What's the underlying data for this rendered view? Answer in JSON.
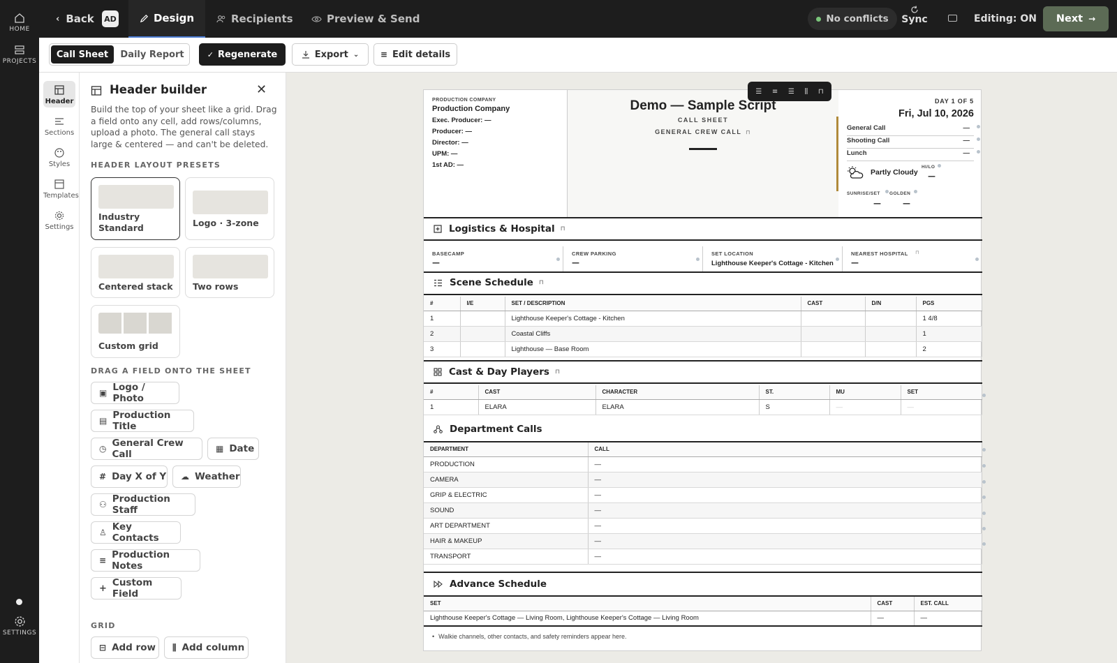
{
  "rail": {
    "home": "HOME",
    "projects": "PROJECTS",
    "settings": "SETTINGS"
  },
  "topbar": {
    "back": "Back",
    "avatar": "AD",
    "tabs": [
      "Design",
      "Recipients",
      "Preview & Send"
    ],
    "status": "No conflicts",
    "sync": "Sync",
    "editing": "Editing: ON",
    "next": "Next"
  },
  "toolbar": {
    "call_sheet": "Call Sheet",
    "daily_report": "Daily Report",
    "regenerate": "Regenerate",
    "export": "Export",
    "edit_details": "Edit details"
  },
  "iconcol": [
    "Header",
    "Sections",
    "Styles",
    "Templates",
    "Settings"
  ],
  "panel": {
    "title": "Header builder",
    "description": "Build the top of your sheet like a grid. Drag a field onto any cell, add rows/columns, upload a photo. The general call stays large & centered — and can't be deleted.",
    "presets_label": "HEADER LAYOUT PRESETS",
    "presets": [
      "Industry Standard",
      "Logo · 3-zone",
      "Centered stack",
      "Two rows",
      "Custom grid"
    ],
    "fields_label": "DRAG A FIELD ONTO THE SHEET",
    "fields": [
      "Logo / Photo",
      "Production Title",
      "General Crew Call",
      "Date",
      "Day X of Y",
      "Weather",
      "Production Staff",
      "Key Contacts",
      "Production Notes",
      "Custom Field"
    ],
    "grid_label": "GRID",
    "grid_buttons": [
      "Add row",
      "Add column"
    ]
  },
  "sheet": {
    "company_label": "PRODUCTION COMPANY",
    "company": "Production Company",
    "staff": [
      "Exec. Producer: —",
      "Producer: —",
      "Director: —",
      "UPM: —",
      "1st AD: —"
    ],
    "title": "Demo — Sample Script",
    "subtitle": "CALL SHEET",
    "crew_call_label": "GENERAL CREW CALL",
    "day": "DAY 1 OF 5",
    "date": "Fri, Jul 10, 2026",
    "calls": [
      {
        "label": "General Call",
        "value": "—"
      },
      {
        "label": "Shooting Call",
        "value": "—"
      },
      {
        "label": "Lunch",
        "value": "—"
      }
    ],
    "weather": "Partly Cloudy",
    "hilo_label": "HI/LO",
    "hilo": "—",
    "sunrise_label": "SUNRISE/SET",
    "sunrise": "—",
    "golden_label": "GOLDEN",
    "golden": "—",
    "logistics": {
      "title": "Logistics & Hospital",
      "cells": [
        {
          "label": "BASECAMP",
          "value": "—"
        },
        {
          "label": "CREW PARKING",
          "value": "—"
        },
        {
          "label": "SET LOCATION",
          "value": "Lighthouse Keeper's Cottage - Kitchen"
        },
        {
          "label": "NEAREST HOSPITAL",
          "value": "—"
        }
      ]
    },
    "scenes": {
      "title": "Scene Schedule",
      "headers": [
        "#",
        "I/E",
        "SET / DESCRIPTION",
        "CAST",
        "D/N",
        "PGS"
      ],
      "rows": [
        [
          "1",
          "",
          "Lighthouse Keeper's Cottage - Kitchen",
          "",
          "",
          "1 4/8"
        ],
        [
          "2",
          "",
          "Coastal Cliffs",
          "",
          "",
          "1"
        ],
        [
          "3",
          "",
          "Lighthouse — Base Room",
          "",
          "",
          "2"
        ]
      ]
    },
    "cast": {
      "title": "Cast & Day Players",
      "headers": [
        "#",
        "CAST",
        "CHARACTER",
        "ST.",
        "MU",
        "SET"
      ],
      "rows": [
        [
          "1",
          "ELARA",
          "ELARA",
          "S",
          "—",
          "—"
        ]
      ]
    },
    "depts": {
      "title": "Department Calls",
      "headers": [
        "DEPARTMENT",
        "CALL"
      ],
      "rows": [
        [
          "PRODUCTION",
          "—"
        ],
        [
          "CAMERA",
          "—"
        ],
        [
          "GRIP & ELECTRIC",
          "—"
        ],
        [
          "SOUND",
          "—"
        ],
        [
          "ART DEPARTMENT",
          "—"
        ],
        [
          "HAIR & MAKEUP",
          "—"
        ],
        [
          "TRANSPORT",
          "—"
        ]
      ]
    },
    "advance": {
      "title": "Advance Schedule",
      "headers": [
        "SET",
        "CAST",
        "EST. CALL"
      ],
      "rows": [
        [
          "Lighthouse Keeper's Cottage — Living Room, Lighthouse Keeper's Cottage — Living Room",
          "—",
          "—"
        ]
      ]
    },
    "note": "Walkie channels, other contacts, and safety reminders appear here."
  },
  "colors": {
    "dark": "#1d1d1d",
    "accent_green": "#5c6b55",
    "status_green": "#7bc67b",
    "accent_bar": "#b08a3a"
  }
}
